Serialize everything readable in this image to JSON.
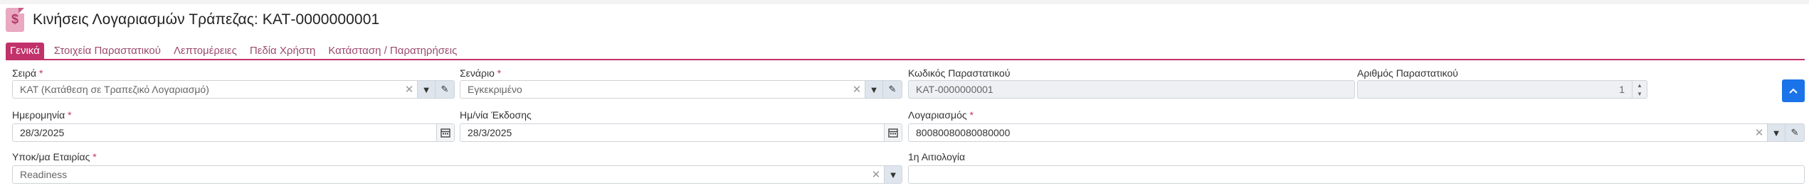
{
  "header": {
    "icon": "dollar-document-icon",
    "title": "Κινήσεις Λογαριασμών Τράπεζας: ΚΑΤ-0000000001"
  },
  "tabs": [
    {
      "label": "Γενικά",
      "active": true
    },
    {
      "label": "Στοιχεία Παραστατικού",
      "active": false
    },
    {
      "label": "Λεπτομέρειες",
      "active": false
    },
    {
      "label": "Πεδία Χρήστη",
      "active": false
    },
    {
      "label": "Κατάσταση / Παρατηρήσεις",
      "active": false
    }
  ],
  "form": {
    "series": {
      "label": "Σειρά",
      "value": "ΚΑΤ (Κατάθεση σε Τραπεζικό Λογαριασμό)"
    },
    "scenario": {
      "label": "Σενάριο",
      "value": "Εγκεκριμένο"
    },
    "doc_code": {
      "label": "Κωδικός Παραστατικού",
      "value": "ΚΑΤ-0000000001"
    },
    "doc_number": {
      "label": "Αριθμός Παραστατικού",
      "value": "1"
    },
    "date": {
      "label": "Ημερομηνία",
      "value": "28/3/2025"
    },
    "issue_date": {
      "label": "Ημ/νία Έκδοσης",
      "value": "28/3/2025"
    },
    "account": {
      "label": "Λογαριασμός",
      "value": "80080080080080000"
    },
    "branch": {
      "label": "Υποκ/μα Εταιρίας",
      "value": "Readiness"
    },
    "reason": {
      "label": "1η Αιτιολογία",
      "value": ""
    }
  },
  "required_mark": "*",
  "colors": {
    "accent": "#c2326a",
    "primary_button": "#1a73e8"
  }
}
